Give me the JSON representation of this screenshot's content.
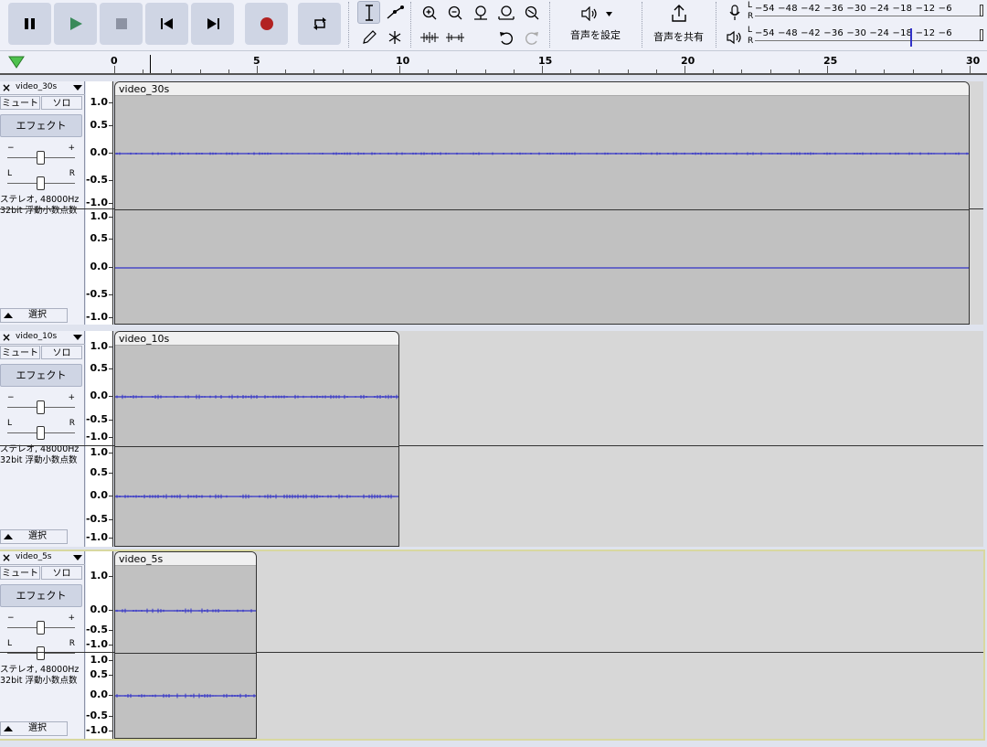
{
  "toolbar": {
    "transport": [
      "pause-icon",
      "play-icon",
      "stop-icon",
      "skip-start-icon",
      "skip-end-icon",
      "record-icon",
      "loop-icon"
    ],
    "audio_setup_label": "音声を設定",
    "share_label": "音声を共有"
  },
  "meters": {
    "record_scale": "−54 −48 −42 −36 −30 −24 −18 −12  −6",
    "play_scale": "−54 −48 −42 −36 −30 −24 −18 −12  −6",
    "l": "L",
    "r": "R"
  },
  "ruler": {
    "labels": [
      "0",
      "5",
      "10",
      "15",
      "20",
      "25",
      "30"
    ]
  },
  "tracks": [
    {
      "name": "video_30s",
      "clip_title": "video_30s",
      "mute": "ミュート",
      "solo": "ソロ",
      "effects": "エフェクト",
      "gain_minus": "−",
      "gain_plus": "+",
      "pan_l": "L",
      "pan_r": "R",
      "info1": "ステレオ, 48000Hz",
      "info2": "32bit 浮動小数点数",
      "select": "選択",
      "scale": [
        "1.0",
        "0.5",
        "0.0",
        "-0.5",
        "-1.0"
      ],
      "duration_s": 30
    },
    {
      "name": "video_10s",
      "clip_title": "video_10s",
      "mute": "ミュート",
      "solo": "ソロ",
      "effects": "エフェクト",
      "gain_minus": "−",
      "gain_plus": "+",
      "pan_l": "L",
      "pan_r": "R",
      "info1": "ステレオ, 48000Hz",
      "info2": "32bit 浮動小数点数",
      "select": "選択",
      "scale": [
        "1.0",
        "0.5",
        "0.0",
        "-0.5",
        "-1.0"
      ],
      "duration_s": 10
    },
    {
      "name": "video_5s",
      "clip_title": "video_5s",
      "mute": "ミュート",
      "solo": "ソロ",
      "effects": "エフェクト",
      "gain_minus": "−",
      "gain_plus": "+",
      "pan_l": "L",
      "pan_r": "R",
      "info1": "ステレオ, 48000Hz",
      "info2": "32bit 浮動小数点数",
      "select": "選択",
      "scale": [
        "1.0",
        "0.0",
        "-0.5",
        "-1.0"
      ],
      "duration_s": 5
    }
  ],
  "colors": {
    "waveform": "#3232c8",
    "record": "#b22222",
    "play": "#3a8a5a",
    "selected_border": "#d8d8a0"
  }
}
